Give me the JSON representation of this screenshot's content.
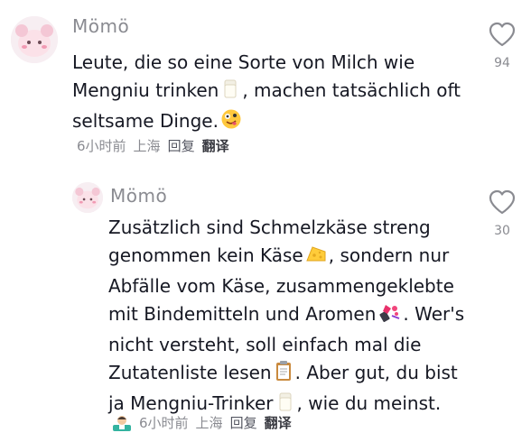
{
  "comments": [
    {
      "username": "Mömö",
      "lines": [
        "Leute, die so eine Sorte von Milch wie",
        "Mengniu trinken",
        ", machen tatsächlich oft",
        "seltsame Dinge."
      ],
      "time": "6小时前",
      "location": "上海",
      "reply": "回复",
      "translate": "翻译",
      "likes": "94",
      "icons": [
        "milk-emoji",
        "zany-face-emoji",
        "heart-outline-icon"
      ]
    },
    {
      "username": "Mömö",
      "lines": [
        "Zusätzlich sind Schmelzkäse streng",
        "genommen kein Käse",
        ", sondern nur",
        "Abfälle vom Käse, zusammengeklebte",
        "mit Bindemitteln und Aromen",
        ". Wer's",
        "nicht versteht, soll einfach mal die",
        "Zutatenliste lesen",
        ". Aber gut, du bist",
        "ja Mengniu-Trinker",
        ", wie du meinst."
      ],
      "time": "6小时前",
      "location": "上海",
      "reply": "回复",
      "translate": "翻译",
      "likes": "30",
      "icons": [
        "cheese-emoji",
        "lipstick-emoji",
        "clipboard-emoji",
        "milk-emoji",
        "person-badge-icon",
        "heart-outline-icon"
      ]
    }
  ],
  "colors": {
    "text": "#161823",
    "muted": "#8a8b91",
    "avatar_bg": "#f6e9ef"
  }
}
